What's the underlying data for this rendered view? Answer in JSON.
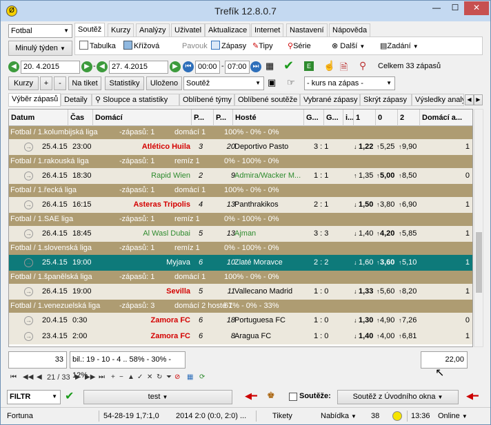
{
  "window": {
    "title": "Trefík 12.8.0.7",
    "min": "—",
    "max": "☐",
    "close": "✕",
    "app_icon": "Ø"
  },
  "left": {
    "sport": "Fotbal",
    "period": "Minulý týden"
  },
  "menu_tabs": [
    "Soutěž",
    "Kurzy",
    "Analýzy",
    "Uživatel",
    "Aktualizace",
    "Internet",
    "Nastavení",
    "Nápověda"
  ],
  "ribbon": {
    "tabulka": "Tabulka",
    "krizova": "Křížová",
    "pavouk": "Pavouk",
    "zapasy": "Zápasy",
    "tipy": "Tipy",
    "serie": "Série",
    "dalsi": "Další",
    "zadani": "Zadání"
  },
  "filters": {
    "date_from": "20. 4.2015",
    "date_to": "27. 4.2015",
    "time_from": "00:00",
    "time_to": "07:00",
    "total": "Celkem 33 zápasů",
    "kurzy": "Kurzy",
    "plus": "+",
    "minus": "-",
    "na_tiket": "Na tiket",
    "statistiky": "Statistiky",
    "ulozeno": "Uloženo",
    "soutez": "Soutěž",
    "kurs": "- kurs na zápas -"
  },
  "subtabs": [
    "Výběr zápasů",
    "Detaily",
    "Sloupce a statistiky",
    "Oblíbené týmy",
    "Oblíbené soutěže",
    "Vybrané zápasy",
    "Skrýt zápasy",
    "Výsledky analý"
  ],
  "columns": [
    "Datum",
    "Čas",
    "Domácí",
    "P...",
    "P...",
    "Hosté",
    "G...",
    "G...",
    "i...",
    "1",
    "0",
    "2",
    "Domácí a..."
  ],
  "groups": [
    {
      "league": "Fotbal / 1.kolumbijská liga",
      "count": "-zápasů: 1",
      "note": "domácí 1",
      "pct": "100% - 0% - 0%"
    },
    {
      "league": "Fotbal / 1.rakouská liga",
      "count": "-zápasů: 1",
      "note": "remíz 1",
      "pct": "0% - 100% - 0%"
    },
    {
      "league": "Fotbal / 1.řecká liga",
      "count": "-zápasů: 1",
      "note": "domácí 1",
      "pct": "100% - 0% - 0%"
    },
    {
      "league": "Fotbal / 1.SAE liga",
      "count": "-zápasů: 1",
      "note": "remíz 1",
      "pct": "0% - 100% - 0%"
    },
    {
      "league": "Fotbal / 1.slovenská liga",
      "count": "-zápasů: 1",
      "note": "remíz 1",
      "pct": "0% - 100% - 0%"
    },
    {
      "league": "Fotbal / 1.španělská liga",
      "count": "-zápasů: 1",
      "note": "domácí 1",
      "pct": "100% - 0% - 0%"
    },
    {
      "league": "Fotbal / 1.venezuelská liga",
      "count": "-zápasů: 3",
      "note": "domácí 2     hosté 1",
      "pct": "67% - 0% - 33%"
    }
  ],
  "matches": [
    {
      "date": "25.4.15",
      "time": "23:00",
      "home": "Atlético Huila",
      "p1": "3",
      "p2": "20",
      "away": "Deportivo Pasto",
      "score": "3 : 1",
      "o1": "1,22",
      "o0": "5,25",
      "o2": "9,90",
      "last": "1"
    },
    {
      "date": "26.4.15",
      "time": "18:30",
      "home": "Rapid Wien",
      "p1": "2",
      "p2": "9",
      "away": "Admira/Wacker M...",
      "score": "1 : 1",
      "o1": "1,35",
      "o0": "5,00",
      "o2": "8,50",
      "last": "0"
    },
    {
      "date": "26.4.15",
      "time": "16:15",
      "home": "Asteras Tripolis",
      "p1": "4",
      "p2": "13",
      "away": "Panthrakikos",
      "score": "2 : 1",
      "o1": "1,50",
      "o0": "3,80",
      "o2": "6,90",
      "last": "1"
    },
    {
      "date": "26.4.15",
      "time": "18:45",
      "home": "Al Wasl Dubai",
      "p1": "5",
      "p2": "13",
      "away": "Ajman",
      "score": "3 : 3",
      "o1": "1,40",
      "o0": "4,20",
      "o2": "5,85",
      "last": "1"
    },
    {
      "date": "25.4.15",
      "time": "19:00",
      "home": "Myjava",
      "p1": "6",
      "p2": "10",
      "away": "Zlaté Moravce",
      "score": "2 : 2",
      "o1": "1,60",
      "o0": "3,60",
      "o2": "5,10",
      "last": "1"
    },
    {
      "date": "26.4.15",
      "time": "19:00",
      "home": "Sevilla",
      "p1": "5",
      "p2": "11",
      "away": "Vallecano Madrid",
      "score": "1 : 0",
      "o1": "1,33",
      "o0": "5,60",
      "o2": "8,20",
      "last": "1"
    },
    {
      "date": "20.4.15",
      "time": "0:30",
      "home": "Zamora FC",
      "p1": "6",
      "p2": "18",
      "away": "Portuguesa FC",
      "score": "1 : 0",
      "o1": "1,30",
      "o0": "4,90",
      "o2": "7,26",
      "last": "0"
    },
    {
      "date": "23.4.15",
      "time": "2:00",
      "home": "Zamora FC",
      "p1": "6",
      "p2": "8",
      "away": "Aragua FC",
      "score": "1 : 0",
      "o1": "1,40",
      "o0": "4,00",
      "o2": "6,81",
      "last": "1"
    }
  ],
  "footer": {
    "count": "33",
    "bil": "bil.: 19 - 10 - 4 .. 58% - 30% - 12%",
    "odds": "22,00"
  },
  "nav": {
    "pos": "21 / 33"
  },
  "bottom": {
    "filtr": "FILTR",
    "test": "test",
    "soutezlbl": "Soutěže:",
    "soutez_uvod": "Soutěž z Úvodního okna"
  },
  "status": {
    "fortuna": "Fortuna",
    "stat1": "54-28-19  1,7:1,0",
    "stat2": "2014 2:0 (0:0, 2:0) ...",
    "tikety": "Tikety",
    "nabidka": "Nabídka",
    "num": "38",
    "time": "13:36",
    "online": "Online"
  },
  "colors": {
    "group_bg": "#ae9c72",
    "row_bg": "#ece8dd",
    "selected": "#0e7a7a",
    "home_red": "#d40000",
    "green": "#2e8b2e"
  }
}
